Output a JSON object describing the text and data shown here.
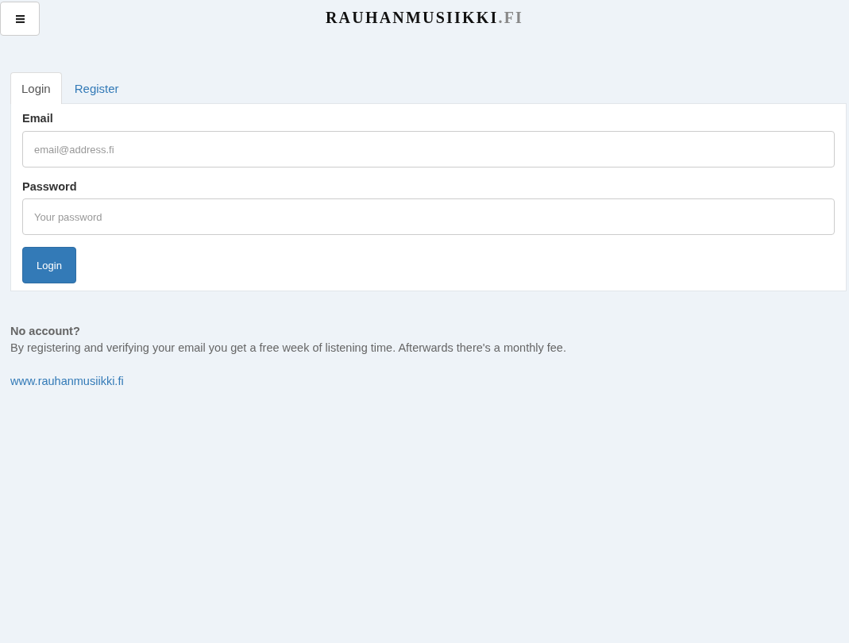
{
  "header": {
    "logo": {
      "name": "RAUHANMUSIIKKI",
      "suffix": ".FI"
    }
  },
  "tabs": [
    {
      "label": "Login",
      "selected": true
    },
    {
      "label": "Register",
      "selected": false
    }
  ],
  "form": {
    "fields": [
      {
        "label": "Email",
        "placeholder": "email@address.fi"
      },
      {
        "label": "Password",
        "placeholder": "Your password"
      }
    ],
    "submit": "Login"
  },
  "info": {
    "heading": "No account?",
    "text": "By registering and verifying your email you get a free week of listening time. Afterwards there's a monthly fee.",
    "link": "www.rauhanmusiikki.fi"
  }
}
